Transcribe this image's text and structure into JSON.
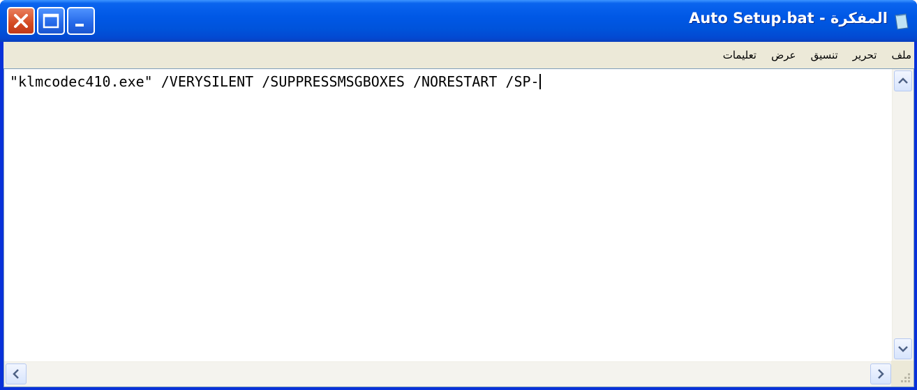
{
  "window": {
    "title": "المفكرة - Auto Setup.bat"
  },
  "menu": {
    "items": [
      "ملف",
      "تحرير",
      "تنسيق",
      "عرض",
      "تعليمات"
    ]
  },
  "editor": {
    "content": "\"klmcodec410.exe\" /VERYSILENT /SUPPRESSMSGBOXES /NORESTART /SP-"
  },
  "colors": {
    "titlebar": "#0058e6",
    "close_button": "#d44a22",
    "menubar_bg": "#ece9d8"
  }
}
